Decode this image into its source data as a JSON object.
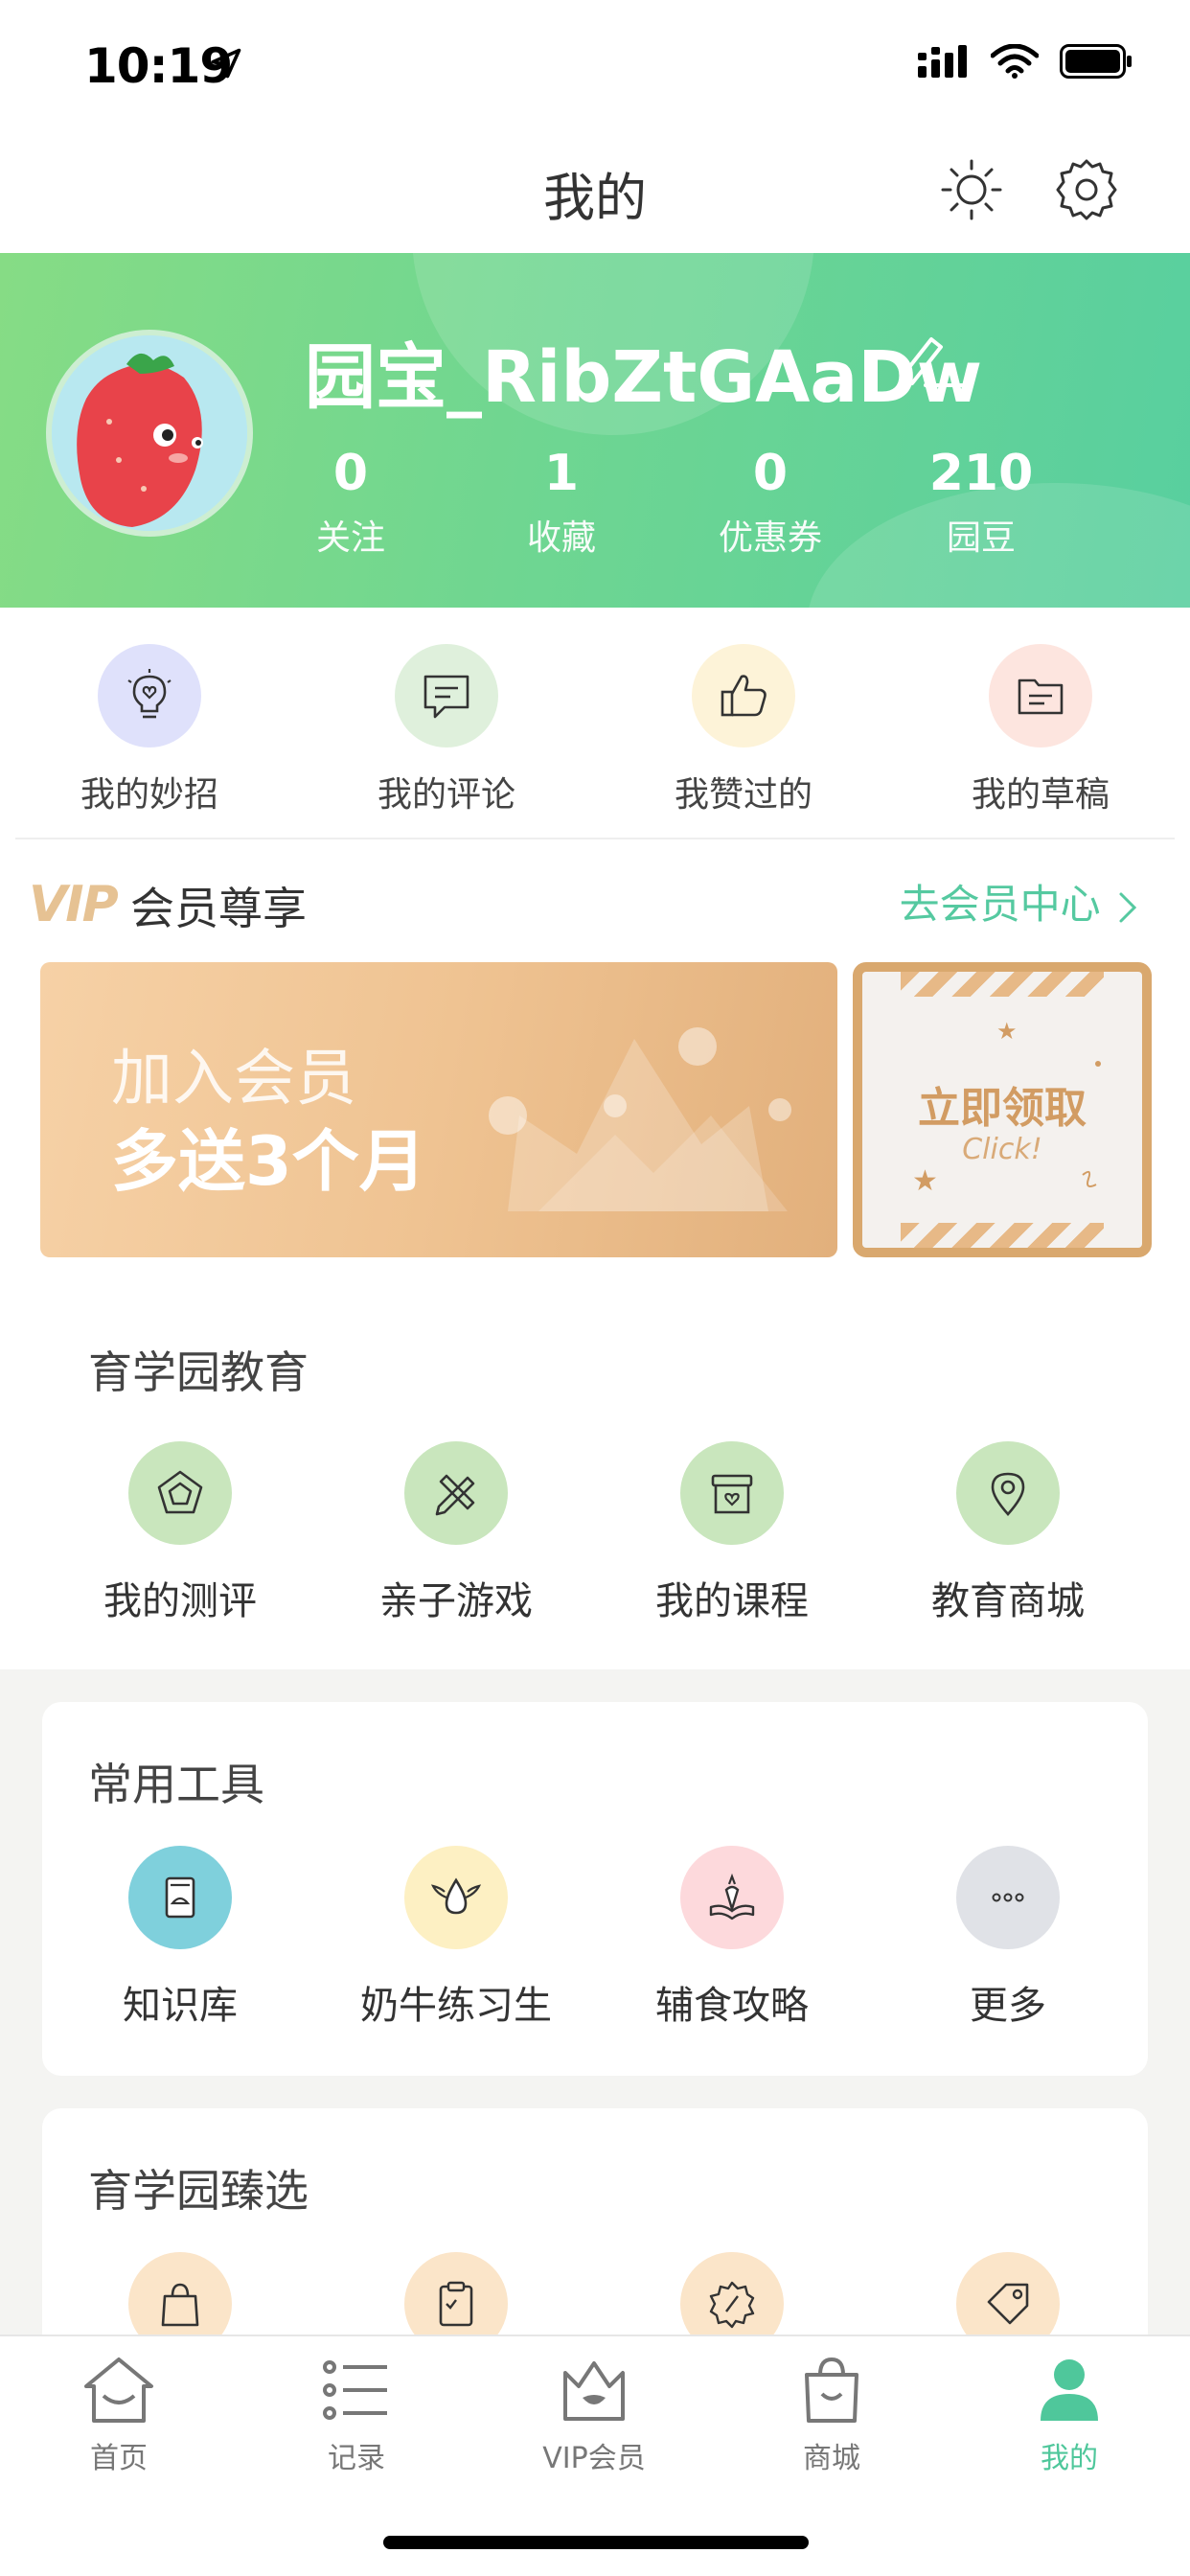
{
  "status_bar": {
    "time": "10:19"
  },
  "nav": {
    "title": "我的"
  },
  "profile": {
    "username": "园宝_RibZtGAaDw",
    "stats": [
      {
        "value": "0",
        "label": "关注"
      },
      {
        "value": "1",
        "label": "收藏"
      },
      {
        "value": "0",
        "label": "优惠券"
      },
      {
        "value": "210",
        "label": "园豆"
      }
    ]
  },
  "quick_actions": [
    {
      "label": "我的妙招",
      "icon": "lightbulb-heart-icon",
      "bg": "#dfe1fb"
    },
    {
      "label": "我的评论",
      "icon": "comment-icon",
      "bg": "#dff0dc"
    },
    {
      "label": "我赞过的",
      "icon": "thumbs-up-icon",
      "bg": "#fdf3d8"
    },
    {
      "label": "我的草稿",
      "icon": "folder-icon",
      "bg": "#fde5df"
    }
  ],
  "vip": {
    "logo": "VIP",
    "title": "会员尊享",
    "link": "去会员中心",
    "banner_line1": "加入会员",
    "banner_line2": "多送3个月",
    "coupon_title": "立即领取",
    "coupon_sub": "Click!"
  },
  "education": {
    "title": "育学园教育",
    "items": [
      {
        "label": "我的测评",
        "icon": "pentagon-icon"
      },
      {
        "label": "亲子游戏",
        "icon": "pencil-ruler-icon"
      },
      {
        "label": "我的课程",
        "icon": "course-box-icon"
      },
      {
        "label": "教育商城",
        "icon": "location-pin-icon"
      }
    ]
  },
  "tools": {
    "title": "常用工具",
    "items": [
      {
        "label": "知识库",
        "icon": "knowledge-book-icon",
        "bg": "#7fd0dc"
      },
      {
        "label": "奶牛练习生",
        "icon": "milk-drop-wings-icon",
        "bg": "#fdf0c3"
      },
      {
        "label": "辅食攻略",
        "icon": "carrot-book-icon",
        "bg": "#fdd9dc"
      },
      {
        "label": "更多",
        "icon": "more-dots-icon",
        "bg": "#e0e2e7"
      }
    ]
  },
  "selection": {
    "title": "育学园臻选",
    "items": [
      {
        "icon": "shopping-bag-icon"
      },
      {
        "icon": "clipboard-check-icon"
      },
      {
        "icon": "discount-badge-icon"
      },
      {
        "icon": "price-tag-icon"
      }
    ]
  },
  "tabbar": [
    {
      "label": "首页",
      "icon": "home-icon"
    },
    {
      "label": "记录",
      "icon": "list-icon"
    },
    {
      "label": "VIP会员",
      "icon": "vip-crown-icon"
    },
    {
      "label": "商城",
      "icon": "shop-bag-icon"
    },
    {
      "label": "我的",
      "icon": "profile-icon",
      "active": true
    }
  ],
  "colors": {
    "accent": "#4fc79b",
    "banner_start": "#86dc85",
    "banner_end": "#58cf9f",
    "vip_gold": "#e6c293"
  }
}
